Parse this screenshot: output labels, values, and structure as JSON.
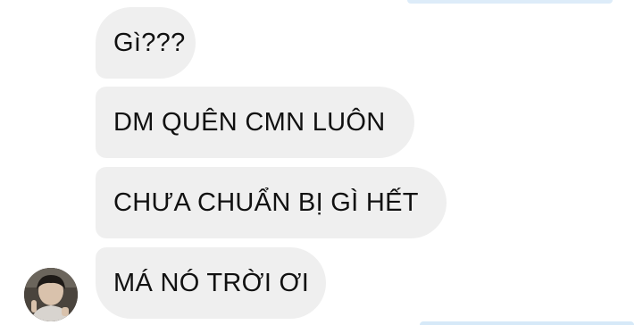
{
  "conversation": {
    "messages": [
      {
        "text": "Gì???"
      },
      {
        "text": "DM QUÊN CMN LUÔN"
      },
      {
        "text": "CHƯA CHUẨN BỊ GÌ HẾT"
      },
      {
        "text": "MÁ NÓ TRỜI ƠI"
      }
    ],
    "sender": {
      "avatar_icon": "contact-avatar"
    }
  },
  "colors": {
    "received_bubble": "#efefef",
    "sent_bubble": "#ddecf9",
    "text": "#111111",
    "background": "#ffffff"
  }
}
